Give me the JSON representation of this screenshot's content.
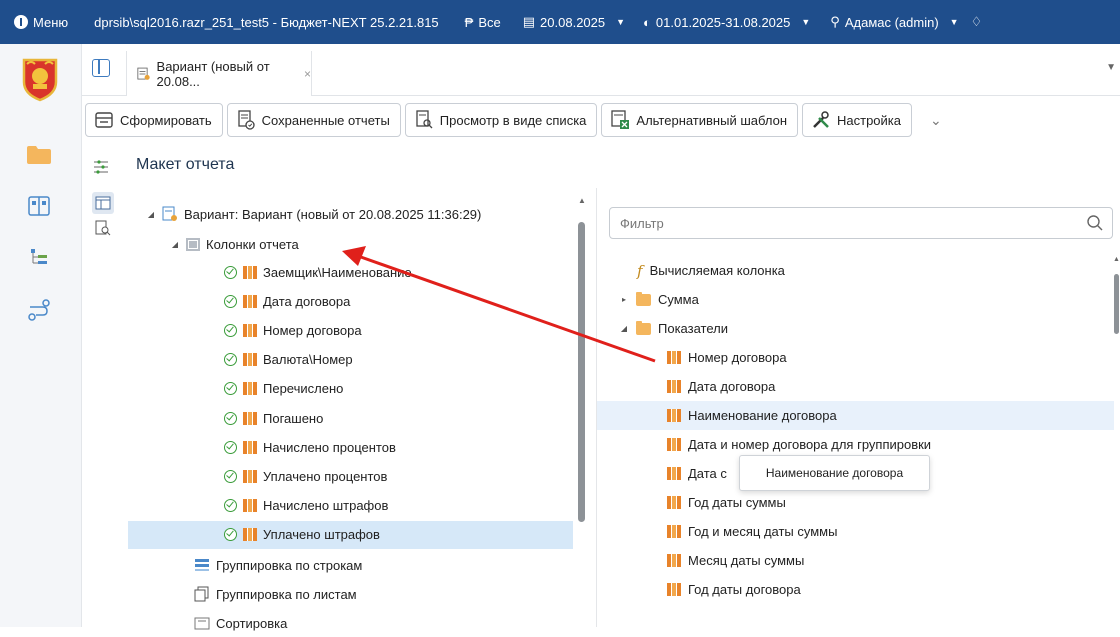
{
  "topbar": {
    "menu_label": "Меню",
    "title": "dprsib\\sql2016.razr_251_test5 - Бюджет-NEXT 25.2.21.815",
    "scope_label": "Все",
    "date_label": "20.08.2025",
    "period_label": "01.01.2025-31.08.2025",
    "user_label": "Адамас (admin)",
    "colors": {
      "bar": "#1f4e8c"
    }
  },
  "tab": {
    "label": "Вариант (новый от 20.08...",
    "close": "×"
  },
  "toolbar": {
    "form_label": "Сформировать",
    "saved_label": "Сохраненные отчеты",
    "list_label": "Просмотр в виде списка",
    "alt_label": "Альтернативный шаблон",
    "settings_label": "Настройка"
  },
  "section_title": "Макет отчета",
  "tree": {
    "root_label": "Вариант: Вариант (новый от 20.08.2025 11:36:29)",
    "columns_label": "Колонки отчета",
    "columns": [
      "Заемщик\\Наименование",
      "Дата договора",
      "Номер договора",
      "Валюта\\Номер",
      "Перечислено",
      "Погашено",
      "Начислено процентов",
      "Уплачено процентов",
      "Начислено штрафов",
      "Уплачено штрафов"
    ],
    "row_grouping_label": "Группировка по строкам",
    "sheet_grouping_label": "Группировка по листам",
    "sorting_label": "Сортировка"
  },
  "right": {
    "filter_placeholder": "Фильтр",
    "calc_label": "Вычисляемая колонка",
    "sum_label": "Сумма",
    "indicators_label": "Показатели",
    "fields": [
      "Номер договора",
      "Дата договора",
      "Наименование договора",
      "Дата и номер договора для группировки",
      "Дата с",
      "Год даты суммы",
      "Год и месяц даты суммы",
      "Месяц даты суммы",
      "Год даты договора"
    ],
    "tooltip": "Наименование договора"
  },
  "icons": [
    "menu-icon",
    "filter-icon",
    "calendar-icon",
    "clock-icon",
    "user-icon",
    "bell-icon",
    "emblem-icon",
    "folder-icon",
    "layout-icon",
    "tree-icon",
    "route-icon",
    "search-icon",
    "column-icon",
    "check-icon"
  ]
}
